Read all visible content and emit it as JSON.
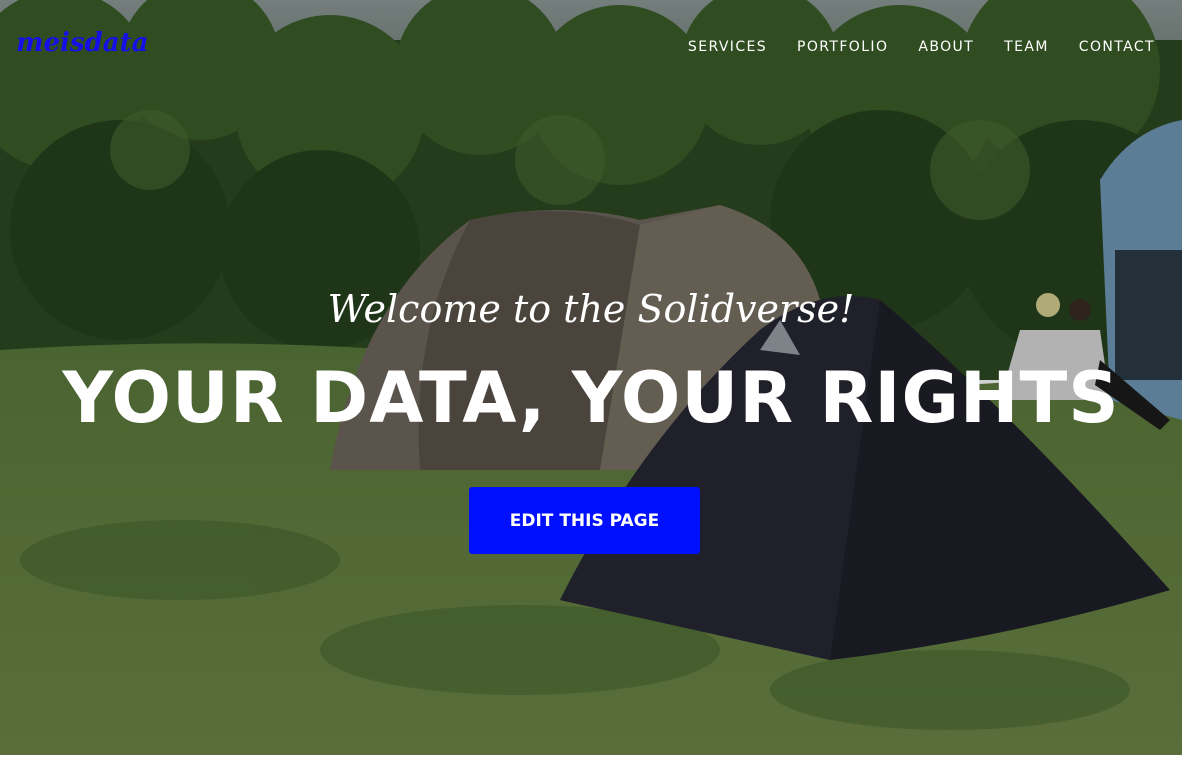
{
  "brand": {
    "logo_text": "meisdata"
  },
  "nav": {
    "items": [
      {
        "label": "SERVICES"
      },
      {
        "label": "PORTFOLIO"
      },
      {
        "label": "ABOUT"
      },
      {
        "label": "TEAM"
      },
      {
        "label": "CONTACT"
      }
    ]
  },
  "hero": {
    "subheading": "Welcome to the Solidverse!",
    "heading": "YOUR DATA, YOUR RIGHTS",
    "button_label": "EDIT THIS PAGE",
    "image_description_icon": "camping-photo"
  },
  "colors": {
    "brand": "#1510e8",
    "button": "#0010ff",
    "nav_text": "#ffffff"
  }
}
